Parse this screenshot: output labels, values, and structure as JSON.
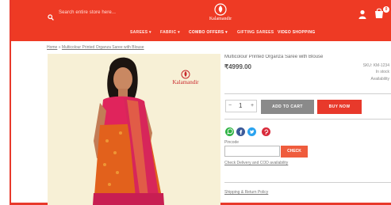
{
  "header": {
    "search_placeholder": "Search entire store here...",
    "brand": "Kalamandir",
    "cart_count": "0"
  },
  "nav": {
    "items": [
      {
        "label": "SAREES ▾"
      },
      {
        "label": "FABRIC ▾"
      },
      {
        "label": "COMBO OFFERS ▾"
      },
      {
        "label": "GIFTING SAREES"
      },
      {
        "label": "VIDEO SHOPPING"
      }
    ]
  },
  "breadcrumb": {
    "home": "Home",
    "separator": "»",
    "current": "Multicolour Printed Organza Saree with Blouse"
  },
  "product": {
    "image_logo": "Kalamandir",
    "title": "Multicolour Printed Organza Saree with Blouse",
    "price": "₹4999.00",
    "meta_line1": "SKU: KM-1234",
    "meta_line2": "In stock",
    "meta_line3": "Availability",
    "quantity": "1",
    "add_to_cart_label": "ADD TO CART",
    "buy_now_label": "BUY NOW"
  },
  "share": {
    "icons": [
      "whatsapp-icon",
      "facebook-icon",
      "twitter-icon",
      "pinterest-icon"
    ]
  },
  "delivery": {
    "pincode_label": "Pincode",
    "check_label": "CHECK",
    "delivery_note": "Check Delivery and COD availability",
    "details_link": "Shipping & Return Policy"
  },
  "colors": {
    "brand_red": "#ee3a24",
    "button_gray": "#8a8a8a",
    "saree_orange": "#e2611c",
    "saree_pink": "#d7265a"
  }
}
